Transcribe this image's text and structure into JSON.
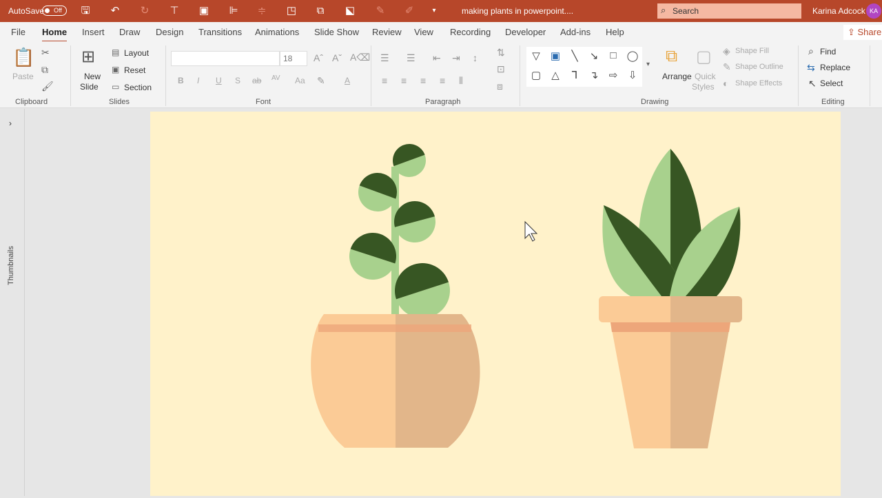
{
  "titlebar": {
    "autosave": "AutoSave",
    "autosave_state": "Off",
    "doc_title": "making plants in powerpoint....",
    "search_placeholder": "Search",
    "user": "Karina Adcock",
    "avatar": "KA",
    "color": "#b7472a"
  },
  "tabs": [
    "File",
    "Home",
    "Insert",
    "Draw",
    "Design",
    "Transitions",
    "Animations",
    "Slide Show",
    "Review",
    "View",
    "Recording",
    "Developer",
    "Add-ins",
    "Help"
  ],
  "active_tab": "Home",
  "share": "Share",
  "ribbon": {
    "clipboard": {
      "label": "Clipboard",
      "paste": "Paste"
    },
    "slides": {
      "label": "Slides",
      "new_slide_1": "New",
      "new_slide_2": "Slide",
      "layout": "Layout",
      "reset": "Reset",
      "section": "Section"
    },
    "font": {
      "label": "Font",
      "font_name": "",
      "font_size": "18",
      "bold": "B",
      "italic": "I",
      "underline": "U",
      "shadow": "S",
      "strike": "ab",
      "spacing": "AV",
      "case": "Aa",
      "color": "A"
    },
    "paragraph": {
      "label": "Paragraph"
    },
    "drawing": {
      "label": "Drawing",
      "arrange": "Arrange",
      "quick_styles_1": "Quick",
      "quick_styles_2": "Styles",
      "shape_fill": "Shape Fill",
      "shape_outline": "Shape Outline",
      "shape_effects": "Shape Effects"
    },
    "editing": {
      "label": "Editing",
      "find": "Find",
      "replace": "Replace",
      "select": "Select"
    }
  },
  "left_pane": {
    "label": "Thumbnails"
  },
  "slide": {
    "background": "#fff2ca",
    "light_green": "#a8d18d",
    "dark_green": "#375623",
    "pot_light": "#fbcb96",
    "pot_dark": "#e2b68a",
    "pot_band": "#eda67a"
  }
}
